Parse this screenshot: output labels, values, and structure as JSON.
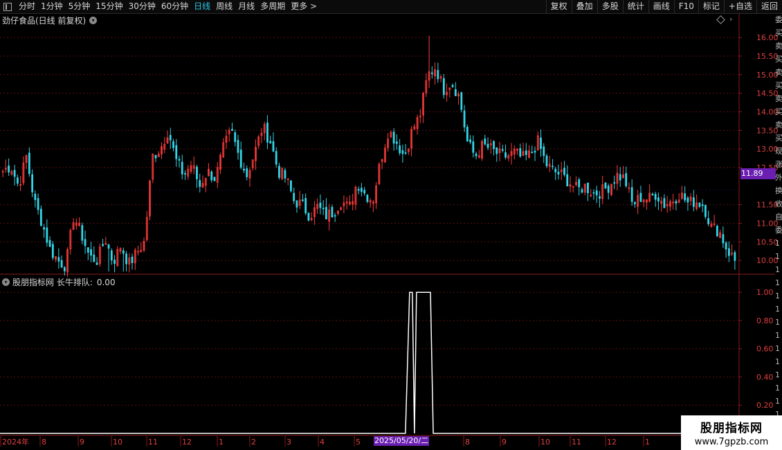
{
  "toolbar": {
    "tabs": [
      "分时",
      "1分钟",
      "5分钟",
      "15分钟",
      "30分钟",
      "60分钟",
      "日线",
      "周线",
      "月线",
      "多周期",
      "更多 >"
    ],
    "active_tab": "日线",
    "right_buttons": [
      "复权",
      "叠加",
      "多股",
      "统计",
      "画线",
      "F10",
      "标记",
      "+自选",
      "返回"
    ]
  },
  "main_chart": {
    "title": "劲仔食品(日线 前复权)",
    "current_price": "11.89",
    "y_ticks": [
      "16.00",
      "15.50",
      "15.00",
      "14.50",
      "14.00",
      "13.50",
      "13.00",
      "12.50",
      "11.50",
      "11.00",
      "10.50",
      "10.00"
    ],
    "y_tick_values": [
      16.0,
      15.5,
      15.0,
      14.5,
      14.0,
      13.5,
      13.0,
      12.5,
      11.5,
      11.0,
      10.5,
      10.0
    ],
    "ylim": [
      9.65,
      16.3
    ],
    "up_color": "#ff3c3c",
    "down_color": "#33d6e8"
  },
  "indicator": {
    "title": "股朋指标网 长牛排队:",
    "value": "0.00",
    "y_ticks": [
      "1.00",
      "0.80",
      "0.60",
      "0.40",
      "0.20"
    ],
    "y_tick_values": [
      1.0,
      0.8,
      0.6,
      0.4,
      0.2
    ],
    "ylim": [
      0,
      1.05
    ]
  },
  "time_axis": {
    "labels": [
      "2024年",
      "8",
      "9",
      "10",
      "11",
      "12",
      "1",
      "2",
      "3",
      "4",
      "5",
      "2025/05/20/二",
      "8",
      "9",
      "10",
      "11",
      "12",
      "1"
    ],
    "selected_date": "2025/05/20/二"
  },
  "side_column": [
    "委",
    "买",
    "卖",
    "买",
    "卖",
    "买",
    "卖",
    "买",
    "卖",
    "买",
    "现",
    "涨",
    "外",
    "换",
    "收",
    "自",
    "委",
    "1",
    "1",
    "1",
    "1",
    "1",
    "1",
    "1",
    "1",
    "1",
    "1",
    "1",
    "1",
    "1",
    "1",
    "1"
  ],
  "watermark": {
    "line1": "股朋指标网",
    "line2": "www.7gpzb.com"
  },
  "chart_data": {
    "type": "candlestick",
    "title": "劲仔食品(日线 前复权)",
    "series": [
      {
        "name": "price",
        "anchors_close": [
          12.4,
          12.55,
          12.0,
          12.8,
          11.6,
          11.0,
          10.3,
          10.0,
          9.85,
          11.2,
          10.7,
          10.1,
          10.0,
          10.6,
          9.95,
          10.4,
          9.9,
          10.2,
          10.5,
          12.8,
          13.0,
          13.5,
          12.7,
          12.3,
          12.6,
          12.0,
          12.4,
          12.2,
          13.0,
          13.5,
          12.8,
          12.3,
          12.9,
          13.6,
          13.2,
          12.4,
          12.2,
          11.6,
          11.5,
          11.2,
          11.45,
          11.2,
          11.3,
          11.6,
          11.4,
          12.1,
          11.8,
          11.6,
          12.7,
          13.5,
          13.2,
          12.8,
          13.5,
          13.9,
          15.0,
          15.2,
          14.6,
          14.8,
          14.4,
          13.2,
          12.8,
          13.1,
          13.0,
          12.85,
          12.8,
          12.9,
          12.75,
          12.85,
          13.2,
          12.6,
          12.4,
          12.3,
          12.1,
          11.9,
          12.0,
          11.8,
          11.85,
          12.0,
          12.3,
          12.2,
          11.5,
          11.7,
          11.65,
          11.8,
          11.5,
          11.6,
          11.8,
          11.55,
          11.6,
          11.5,
          10.9,
          10.8,
          10.3,
          10.0
        ],
        "high": 16.05,
        "low": 9.7
      }
    ],
    "indicator_series": {
      "name": "长牛排队",
      "x_range_active": [
        0.498,
        0.53
      ],
      "value_active": 1.0,
      "value_idle": 0.0
    }
  }
}
